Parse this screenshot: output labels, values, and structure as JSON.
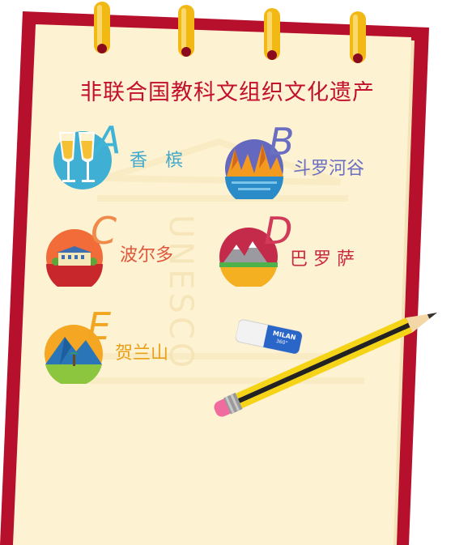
{
  "title": "非联合国教科文组织文化遗产",
  "watermark": "UNESCO",
  "eraser_text": {
    "brand": "MILAN",
    "model": "360°"
  },
  "colors": {
    "frame": "#b7102d",
    "paper": "#fdf2d2",
    "ring": "#f2b814",
    "title": "#c2102e"
  },
  "items": [
    {
      "letter": "A",
      "label": "香　槟",
      "icon": "champagne-icon",
      "letter_color": "#3fb4d7",
      "label_color": "#3fa8cc"
    },
    {
      "letter": "B",
      "label": "斗罗河谷",
      "icon": "douro-valley-icon",
      "letter_color": "#6a6fc2",
      "label_color": "#6a6fc2"
    },
    {
      "letter": "C",
      "label": "波尔多",
      "icon": "bordeaux-icon",
      "letter_color": "#f08a4b",
      "label_color": "#e0583c"
    },
    {
      "letter": "D",
      "label": "巴 罗 萨",
      "icon": "barossa-icon",
      "letter_color": "#d23a5a",
      "label_color": "#c9283e"
    },
    {
      "letter": "E",
      "label": "贺兰山",
      "icon": "helan-mountain-icon",
      "letter_color": "#f2a521",
      "label_color": "#e9a019"
    }
  ]
}
